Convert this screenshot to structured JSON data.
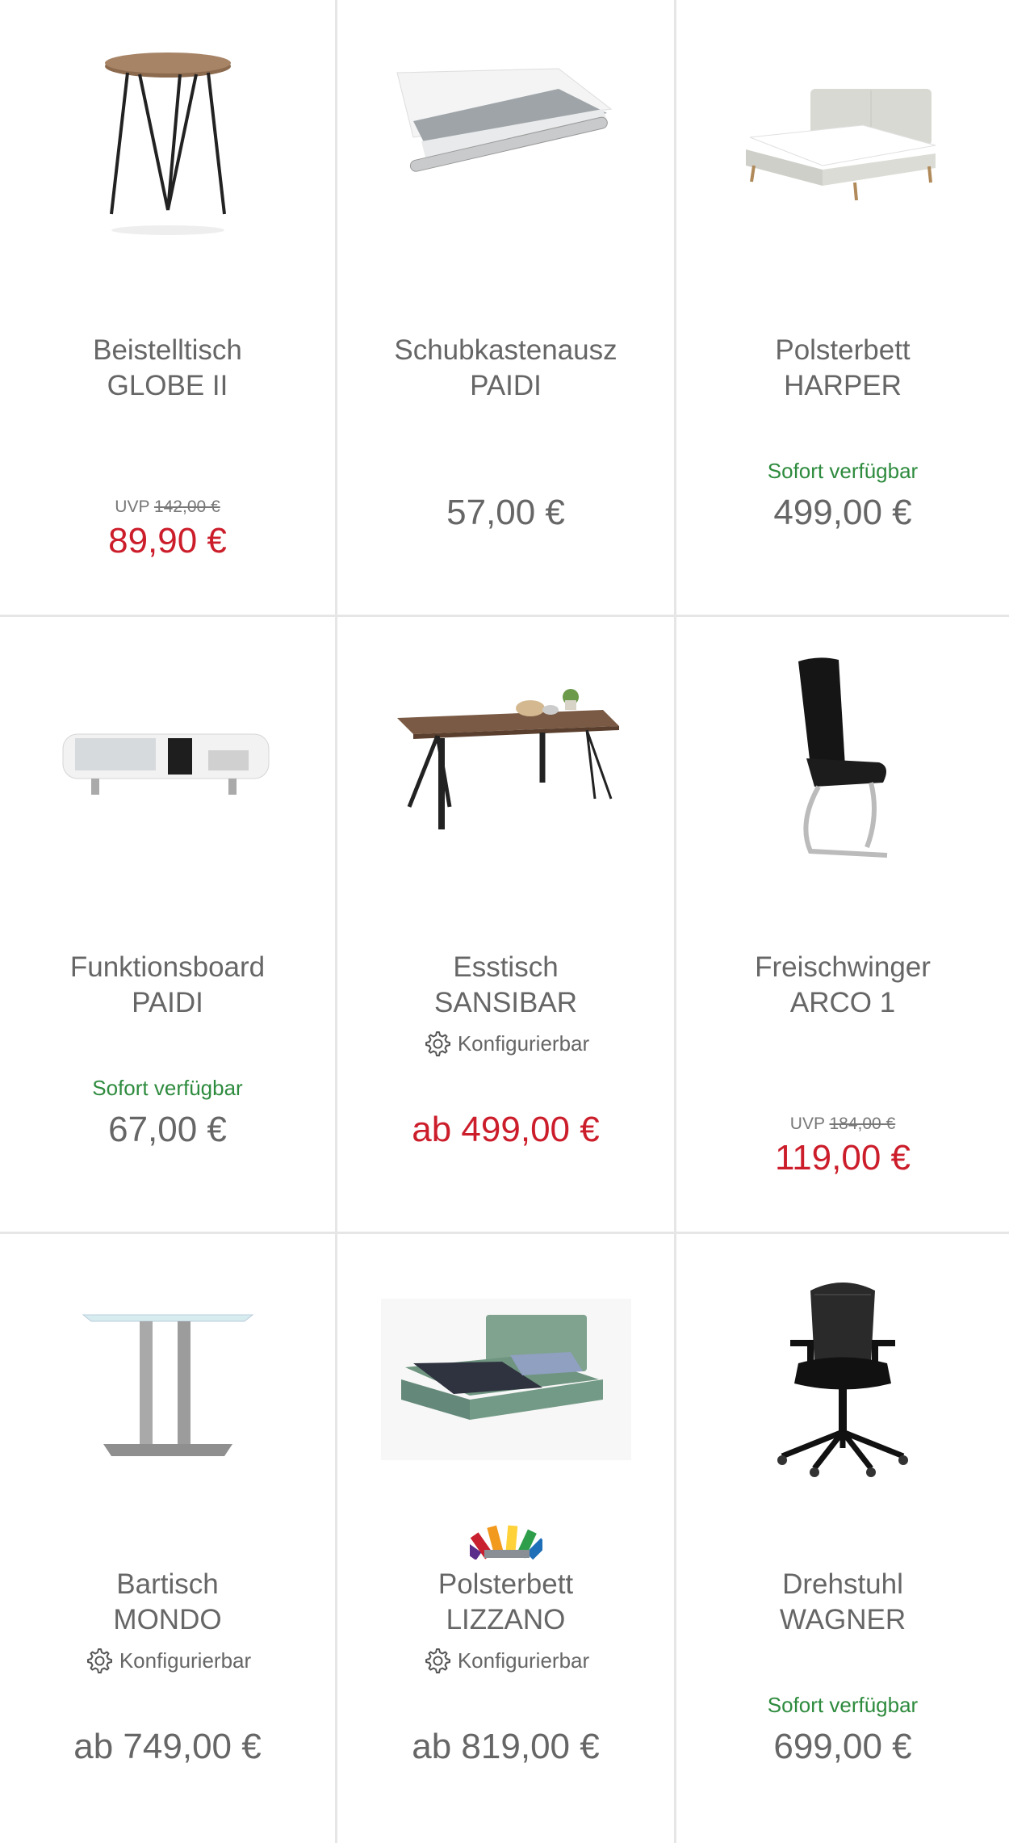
{
  "colors": {
    "accent_red": "#cc1d2b",
    "available_green": "#2e8b3e",
    "divider": "#e6e6e6",
    "text": "#666666"
  },
  "products": [
    {
      "name_line1": "Beistelltisch",
      "name_line2": "GLOBE II",
      "image_icon": "side-table-image",
      "uvp_label": "UVP",
      "uvp_old": "142,00 €",
      "price": "89,90 €"
    },
    {
      "name_line1": "Schubkastenausz",
      "name_line2": "PAIDI",
      "image_icon": "drawer-image",
      "price": "57,00 €"
    },
    {
      "name_line1": "Polsterbett",
      "name_line2": "HARPER",
      "image_icon": "upholstered-bed-image",
      "availability": "Sofort verfügbar",
      "price": "499,00 €"
    },
    {
      "name_line1": "Funktionsboard",
      "name_line2": "PAIDI",
      "image_icon": "function-board-image",
      "availability": "Sofort verfügbar",
      "price": "67,00 €"
    },
    {
      "name_line1": "Esstisch",
      "name_line2": "SANSIBAR",
      "image_icon": "dining-table-image",
      "config_label": "Konfigurierbar",
      "price": "ab 499,00 €"
    },
    {
      "name_line1": "Freischwinger",
      "name_line2": "ARCO 1",
      "image_icon": "cantilever-chair-image",
      "uvp_label": "UVP",
      "uvp_old": "184,00 €",
      "price": "119,00 €"
    },
    {
      "name_line1": "Bartisch",
      "name_line2": "MONDO",
      "image_icon": "bar-table-image",
      "config_label": "Konfigurierbar",
      "price": "ab 749,00 €"
    },
    {
      "name_line1": "Polsterbett",
      "name_line2": "LIZZANO",
      "image_icon": "green-bed-image",
      "swatch_icon": "color-swatch-icon",
      "config_label": "Konfigurierbar",
      "price": "ab 819,00 €"
    },
    {
      "name_line1": "Drehstuhl",
      "name_line2": "WAGNER",
      "image_icon": "office-chair-image",
      "availability": "Sofort verfügbar",
      "price": "699,00 €"
    }
  ]
}
